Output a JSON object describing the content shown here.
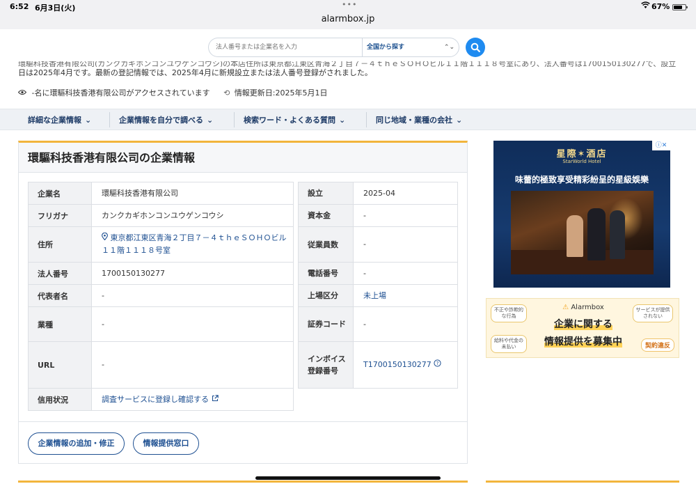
{
  "status_bar": {
    "time": "6:52",
    "date": "6月3日(火)",
    "battery": "67%"
  },
  "browser": {
    "url": "alarmbox.jp"
  },
  "search": {
    "placeholder": "法人番号または企業名を入力",
    "scope": "全国から探す"
  },
  "summary": {
    "line1_partial": "環驅科技香港有限公司(カンクカギホンコンユウゲンコウシ)の本店住所は東京都江東区青海２丁目７－４ｔｈｅＳＯＨＯビル１１階１１１８号室にあり、法人番号は1700150130277で、設立",
    "line2": "日は2025年4月です。最新の登記情報では、2025年4月に新規設立または法人番号登録がされました。",
    "views": "-名に環驅科技香港有限公司がアクセスされています",
    "updated": "情報更新日:2025年5月1日"
  },
  "nav": {
    "items": [
      {
        "label": "詳細な企業情報"
      },
      {
        "label": "企業情報を自分で調べる"
      },
      {
        "label": "検索ワード・よくある質問"
      },
      {
        "label": "同じ地域・業種の会社"
      }
    ]
  },
  "company": {
    "title": "環驅科技香港有限公司の企業情報",
    "left": {
      "name_label": "企業名",
      "name": "環驅科技香港有限公司",
      "kana_label": "フリガナ",
      "kana": "カンクカギホンコンユウゲンコウシ",
      "address_label": "住所",
      "address": "東京都江東区青海２丁目７－４ｔｈｅＳＯＨＯビル１１階１１１８号室",
      "corp_no_label": "法人番号",
      "corp_no": "1700150130277",
      "rep_label": "代表者名",
      "rep": "-",
      "industry_label": "業種",
      "industry": "-",
      "url_label": "URL",
      "url": "-",
      "credit_label": "信用状況",
      "credit": "調査サービスに登録し確認する"
    },
    "right": {
      "founded_label": "設立",
      "founded": "2025-04",
      "capital_label": "資本金",
      "capital": "-",
      "employees_label": "従業員数",
      "employees": "-",
      "phone_label": "電話番号",
      "phone": "-",
      "listing_label": "上場区分",
      "listing": "未上場",
      "securities_label": "証券コード",
      "securities": "-",
      "invoice_label_1": "インボイス",
      "invoice_label_2": "登録番号",
      "invoice": "T1700150130277"
    },
    "buttons": {
      "edit": "企業情報の追加・修正",
      "contact": "情報提供窓口"
    }
  },
  "ads": {
    "ad1": {
      "logo": "星際✶酒店",
      "logo_sub": "StarWorld Hotel",
      "headline": "味蕾的極致享受精彩紛呈的星級娛樂"
    },
    "ad2": {
      "brand": "Alarmbox",
      "line1": "企業に関する",
      "line2": "情報提供を募集中",
      "bubble1": "不正や詐欺的な行為",
      "bubble2": "サービスが提供されない",
      "bubble3": "給料や代金の未払い",
      "tag": "契約違反"
    }
  }
}
